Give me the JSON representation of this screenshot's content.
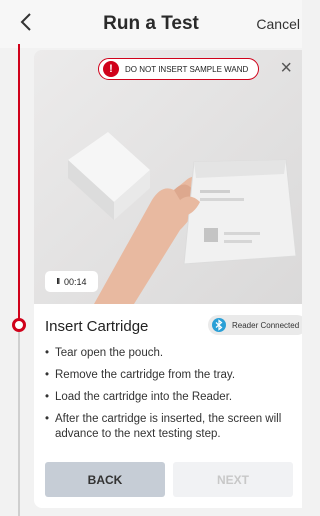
{
  "header": {
    "back_icon": "chevron-left-icon",
    "title": "Run a Test",
    "cancel_label": "Cancel"
  },
  "video": {
    "warning_text": "DO NOT INSERT SAMPLE WAND",
    "warning_icon": "!",
    "close_icon": "×",
    "timer_icon": "II",
    "timer": "00:14"
  },
  "step": {
    "title": "Insert Cartridge",
    "reader_status": "Reader Connected",
    "reader_icon": "bluetooth-icon",
    "instructions": [
      "Tear open the pouch.",
      "Remove the cartridge from the tray.",
      "Load the cartridge into the Reader.",
      "After the cartridge is inserted, the screen will advance to the next testing step."
    ]
  },
  "footer": {
    "back_label": "BACK",
    "next_label": "NEXT"
  },
  "colors": {
    "accent": "#d0021b",
    "bluetooth": "#2a9fd6",
    "back_button": "#c6cdd6"
  }
}
